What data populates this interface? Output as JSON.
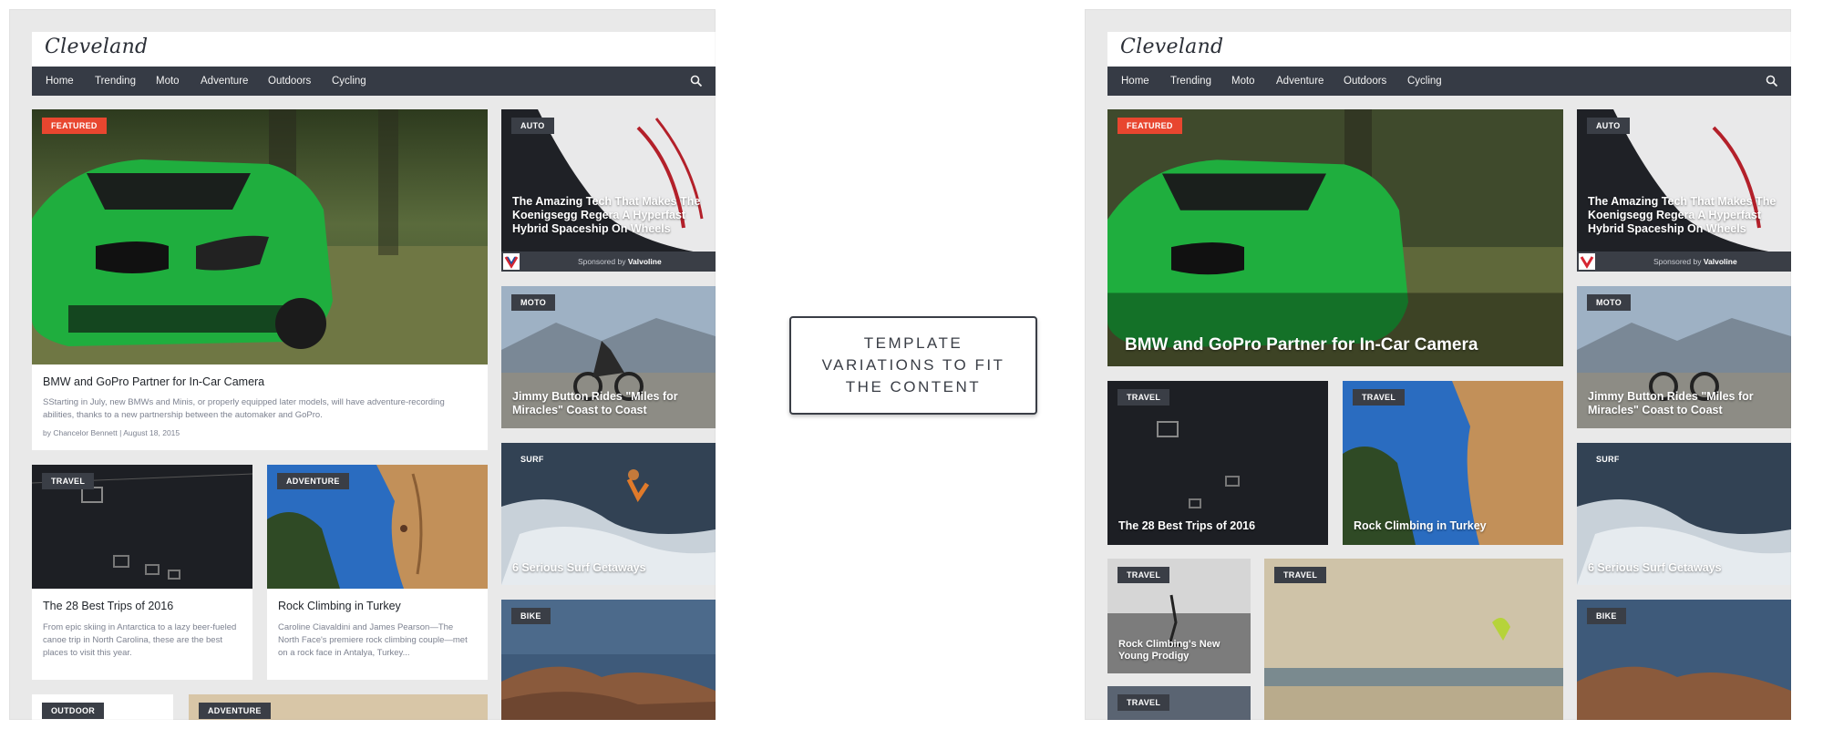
{
  "site": {
    "logo": "Cleveland",
    "nav": [
      "Home",
      "Trending",
      "Moto",
      "Adventure",
      "Outdoors",
      "Cycling"
    ]
  },
  "center_label": "TEMPLATE VARIATIONS TO FIT THE CONTENT",
  "featured": {
    "badge": "FEATURED",
    "title": "BMW and GoPro Partner for In-Car Camera",
    "excerpt": "SStarting in July, new BMWs and Minis, or properly equipped later models, will have adventure-recording abilities, thanks to a new partnership between the automaker and GoPro.",
    "author": "by Chancelor Bennett",
    "date": "August 18, 2015"
  },
  "auto": {
    "badge": "AUTO",
    "title": "The Amazing Tech That Makes The Koenigsegg Regera A Hyperfast Hybrid Spaceship On Wheels",
    "sponsored_by": "Sponsored by",
    "sponsor": "Valvoline"
  },
  "moto": {
    "badge": "MOTO",
    "title": "Jimmy Button Rides \"Miles for Miracles\" Coast to Coast"
  },
  "surf": {
    "badge": "SURF",
    "title": "6 Serious Surf Getaways"
  },
  "bike": {
    "badge": "BIKE"
  },
  "trips": {
    "badge": "TRAVEL",
    "title": "The 28 Best Trips of 2016",
    "excerpt": "From epic skiing in Antarctica to a lazy beer-fueled canoe trip in North Carolina, these are the best places to visit this year."
  },
  "climb": {
    "badge_left": "ADVENTURE",
    "badge_right": "TRAVEL",
    "title": "Rock Climbing in Turkey",
    "excerpt": "Caroline Ciavaldini and James Pearson—The North Face's premiere rock climbing couple—met on a rock face in Antalya, Turkey..."
  },
  "outdoor": {
    "badge": "OUTDOOR"
  },
  "adventure_bottom": {
    "badge": "ADVENTURE"
  },
  "prodigy": {
    "badge": "TRAVEL",
    "title": "Rock Climbing's New Young Prodigy"
  },
  "kite": {
    "badge": "TRAVEL"
  },
  "travel_small": {
    "badge": "TRAVEL"
  }
}
